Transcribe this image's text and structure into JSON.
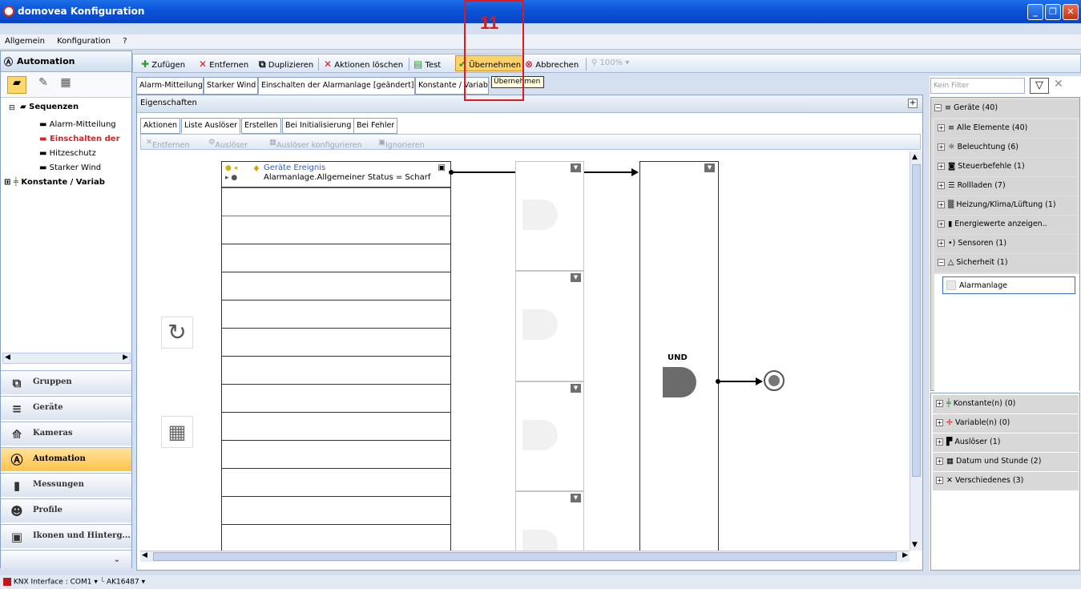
{
  "window": {
    "title": "domovea Konfiguration"
  },
  "menu": [
    "Allgemein",
    "Konfiguration",
    "?"
  ],
  "left": {
    "header": "Automation",
    "tree": {
      "sequenzen": "Sequenzen",
      "items": [
        "Alarm-Mitteilung",
        "Einschalten der",
        "Hitzeschutz",
        "Starker Wind"
      ],
      "konstante": "Konstante / Variab"
    },
    "nav": [
      "Gruppen",
      "Geräte",
      "Kameras",
      "Automation",
      "Messungen",
      "Profile",
      "Ikonen und Hinterg..."
    ]
  },
  "toolbar": {
    "add": "Zufügen",
    "remove": "Entfernen",
    "duplicate": "Duplizieren",
    "delete_actions": "Aktionen löschen",
    "test": "Test",
    "apply": "Übernehmen",
    "cancel": "Abbrechen",
    "zoom": "100%",
    "tooltip": "Übernehmen"
  },
  "doc_tabs": [
    "Alarm-Mitteilung",
    "Starker Wind",
    "Einschalten der Alarmanlage [geändert]",
    "Konstante / Variab"
  ],
  "props": {
    "title": "Eigenschaften",
    "tabs": [
      "Aktionen",
      "Liste Auslöser",
      "Erstellen",
      "Bei Initialisierung",
      "Bei Fehler"
    ],
    "subtoolbar": [
      "Entfernen",
      "Auslöser",
      "Auslöser konfigurieren",
      "Ignorieren"
    ],
    "trigger": {
      "title": "Geräte Ereignis",
      "detail": "Alarmanlage.Allgemeiner Status = Scharf"
    },
    "gate_label": "UND"
  },
  "right": {
    "filter_placeholder": "Kein Filter",
    "devices": {
      "header": "Geräte (40)",
      "items": [
        "Alle Elemente (40)",
        "Beleuchtung (6)",
        "Steuerbefehle (1)",
        "Rollladen (7)",
        "Heizung/Klima/Lüftung (1)",
        "Energiewerte anzeigen..",
        "Sensoren (1)",
        "Sicherheit (1)"
      ],
      "selected": "Alarmanlage"
    },
    "lower": [
      "Konstante(n) (0)",
      "Variable(n) (0)",
      "Auslöser (1)",
      "Datum und Stunde (2)",
      "Verschiedenes (3)"
    ]
  },
  "status": {
    "interface": "KNX Interface : COM1",
    "device": "AK16487"
  },
  "annotation": {
    "label": "11",
    "color": "#e01a1a"
  }
}
